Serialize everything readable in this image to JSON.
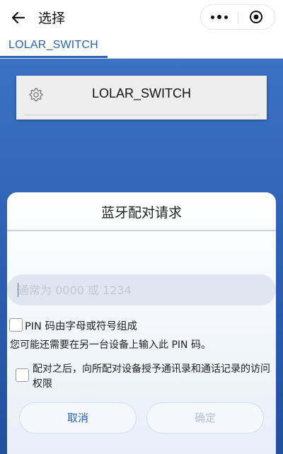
{
  "header": {
    "title": "选择"
  },
  "tabs": [
    {
      "label": "LOLAR_SWITCH",
      "active": true
    }
  ],
  "device_list": [
    {
      "name": "LOLAR_SWITCH",
      "icon": "gear-icon"
    }
  ],
  "dialog": {
    "title": "蓝牙配对请求",
    "pin_input": {
      "value": "",
      "placeholder": "通常为 0000 或 1234"
    },
    "pin_alpha_checkbox": {
      "label": "PIN 码由字母或符号组成",
      "checked": false
    },
    "note": "您可能还需要在另一台设备上输入此 PIN 码。",
    "contacts_checkbox": {
      "label": "配对之后，向所配对设备授予通讯录和通话记录的访问权限",
      "checked": false
    },
    "cancel_label": "取消",
    "confirm_label": "确定"
  },
  "colors": {
    "accent": "#2a63b5",
    "background_blue": "#2b5cae",
    "disabled_text": "#b4c1d3"
  }
}
